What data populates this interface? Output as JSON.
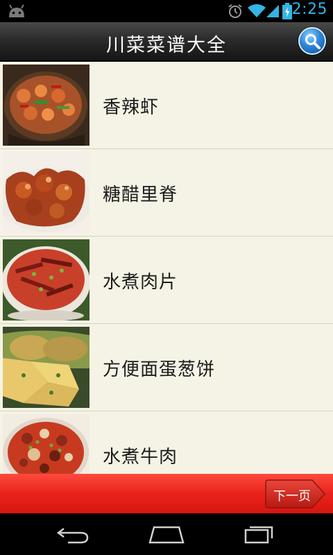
{
  "status_bar": {
    "time": "2:25",
    "icons": [
      "android-icon",
      "alarm-icon",
      "wifi-icon",
      "signal-icon",
      "battery-icon"
    ]
  },
  "header": {
    "title": "川菜菜谱大全",
    "search_icon": "search-icon"
  },
  "recipes": [
    {
      "name": "香辣虾"
    },
    {
      "name": "糖醋里脊"
    },
    {
      "name": "水煮肉片"
    },
    {
      "name": "方便面蛋葱饼"
    },
    {
      "name": "水煮牛肉"
    }
  ],
  "footer": {
    "next_page_label": "下一页"
  },
  "nav_bar": {
    "icons": [
      "back-icon",
      "home-icon",
      "recent-apps-icon"
    ]
  },
  "colors": {
    "list_background": "#f5f3e5",
    "footer_red": "#e8231b",
    "status_blue": "#33b5e5"
  }
}
